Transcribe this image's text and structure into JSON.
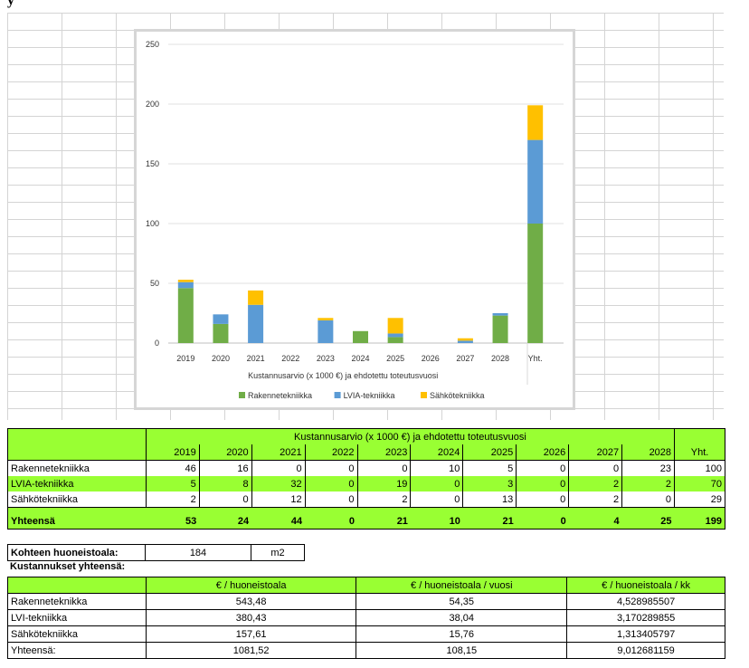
{
  "header_fragment": "y",
  "colors": {
    "rakenne": "#70ad47",
    "lvia": "#5b9bd5",
    "sahko": "#ffc000",
    "highlight": "#99ff33"
  },
  "chart_data": {
    "type": "bar",
    "stacked": true,
    "categories": [
      "2019",
      "2020",
      "2021",
      "2022",
      "2023",
      "2024",
      "2025",
      "2026",
      "2027",
      "2028",
      "Yht."
    ],
    "series": [
      {
        "name": "Rakennetekniikka",
        "values": [
          46,
          16,
          0,
          0,
          0,
          10,
          5,
          0,
          0,
          23,
          100
        ]
      },
      {
        "name": "LVIA-tekniikka",
        "values": [
          5,
          8,
          32,
          0,
          19,
          0,
          3,
          0,
          2,
          2,
          70
        ]
      },
      {
        "name": "Sähkötekniikka",
        "values": [
          2,
          0,
          12,
          0,
          2,
          0,
          13,
          0,
          2,
          0,
          29
        ]
      }
    ],
    "xlabel": "Kustannusarvio (x 1000 €) ja ehdotettu toteutusvuosi",
    "ylim": [
      0,
      250
    ],
    "yticks": [
      0,
      50,
      100,
      150,
      200,
      250
    ],
    "legend": "bottom"
  },
  "table1": {
    "title": "Kustannusarvio (x 1000 €) ja ehdotettu toteutusvuosi",
    "years": [
      "2019",
      "2020",
      "2021",
      "2022",
      "2023",
      "2024",
      "2025",
      "2026",
      "2027",
      "2028"
    ],
    "total_header": "Yht.",
    "rows": [
      {
        "label": "Rakennetekniikka",
        "values": [
          "46",
          "16",
          "0",
          "0",
          "0",
          "10",
          "5",
          "0",
          "0",
          "23"
        ],
        "total": "100"
      },
      {
        "label": "LVIA-tekniikka",
        "values": [
          "5",
          "8",
          "32",
          "0",
          "19",
          "0",
          "3",
          "0",
          "2",
          "2"
        ],
        "total": "70"
      },
      {
        "label": "Sähkötekniikka",
        "values": [
          "2",
          "0",
          "12",
          "0",
          "2",
          "0",
          "13",
          "0",
          "2",
          "0"
        ],
        "total": "29"
      }
    ],
    "sum": {
      "label": "Yhteensä",
      "values": [
        "53",
        "24",
        "44",
        "0",
        "21",
        "10",
        "21",
        "0",
        "4",
        "25"
      ],
      "total": "199"
    }
  },
  "area": {
    "label": "Kohteen huoneistoala:",
    "value": "184",
    "unit": "m2"
  },
  "table2": {
    "title": "Kustannukset yhteensä:",
    "headers": [
      "€ / huoneistoala",
      "€ / huoneistoala / vuosi",
      "€ / huoneistoala / kk"
    ],
    "rows": [
      {
        "label": "Rakenneteknikka",
        "values": [
          "543,48",
          "54,35",
          "4,528985507"
        ]
      },
      {
        "label": "LVI-tekniikka",
        "values": [
          "380,43",
          "38,04",
          "3,170289855"
        ]
      },
      {
        "label": "Sähkötekniikka",
        "values": [
          "157,61",
          "15,76",
          "1,313405797"
        ]
      },
      {
        "label": "Yhteensä:",
        "values": [
          "1081,52",
          "108,15",
          "9,012681159"
        ]
      }
    ]
  }
}
